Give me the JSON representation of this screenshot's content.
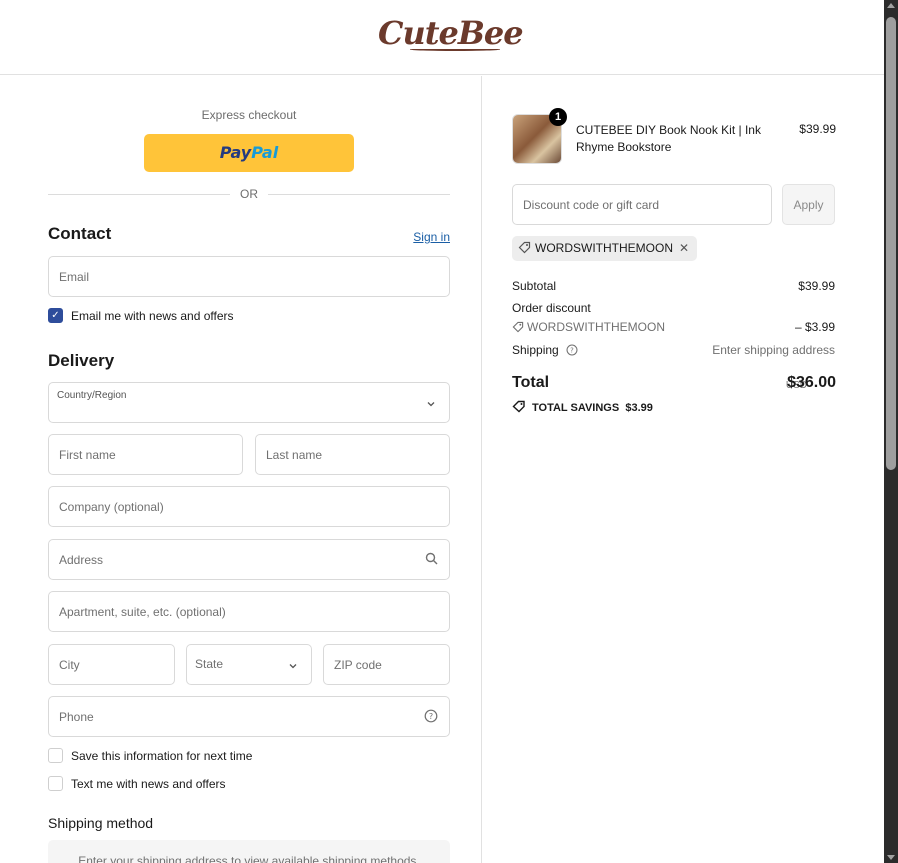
{
  "header": {
    "logo_text": "CuteBee"
  },
  "express": {
    "title": "Express checkout",
    "paypal_part1": "Pay",
    "paypal_part2": "Pal",
    "or_text": "OR"
  },
  "contact": {
    "title": "Contact",
    "signin_label": "Sign in",
    "email_placeholder": "Email",
    "news_checkbox_label": "Email me with news and offers",
    "news_checked": true
  },
  "delivery": {
    "title": "Delivery",
    "country_label": "Country/Region",
    "first_name_placeholder": "First name",
    "last_name_placeholder": "Last name",
    "company_placeholder": "Company (optional)",
    "address_placeholder": "Address",
    "apartment_placeholder": "Apartment, suite, etc. (optional)",
    "city_placeholder": "City",
    "state_label": "State",
    "zip_placeholder": "ZIP code",
    "phone_placeholder": "Phone",
    "save_info_label": "Save this information for next time",
    "text_news_label": "Text me with news and offers"
  },
  "shipping_method": {
    "title": "Shipping method",
    "placeholder_text": "Enter your shipping address to view available shipping methods."
  },
  "order": {
    "product": {
      "name": "CUTEBEE DIY Book Nook Kit | Ink Rhyme Bookstore",
      "price": "$39.99",
      "quantity": "1"
    },
    "discount_placeholder": "Discount code or gift card",
    "apply_label": "Apply",
    "applied_code": "WORDSWITHTHEMOON",
    "subtotal_label": "Subtotal",
    "subtotal_value": "$39.99",
    "order_discount_label": "Order discount",
    "discount_code": "WORDSWITHTHEMOON",
    "discount_value": "– $3.99",
    "shipping_label": "Shipping",
    "shipping_value": "Enter shipping address",
    "total_label": "Total",
    "total_currency": "USD",
    "total_value": "$36.00",
    "savings_label": "TOTAL SAVINGS",
    "savings_value": "$3.99"
  },
  "colors": {
    "paypal_yellow": "#ffc439",
    "link_blue": "#1a5ea5",
    "checkbox_blue": "#2e4d9b",
    "brand_brown": "#6b3a2c"
  }
}
